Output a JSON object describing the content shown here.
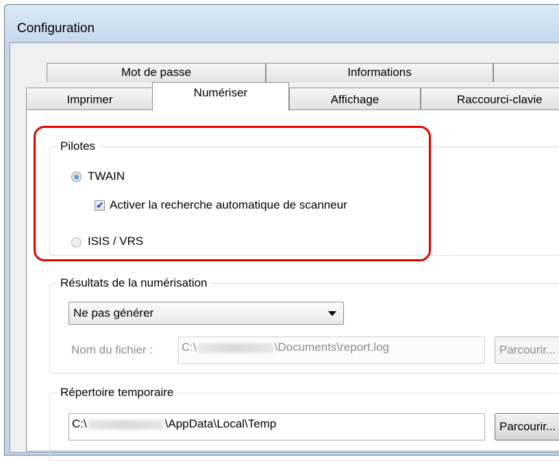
{
  "window": {
    "title": "Configuration"
  },
  "tabs": {
    "row_top": [
      "Mot de passe",
      "Informations",
      ""
    ],
    "row_bottom": [
      "Imprimer",
      "Numériser",
      "Affichage",
      "Raccourci-clavie"
    ]
  },
  "drivers": {
    "group_label": "Pilotes",
    "twain_label": "TWAIN",
    "twain_checked": true,
    "auto_search_label": "Activer la recherche automatique de scanneur",
    "auto_search_checked": true,
    "isis_label": "ISIS / VRS",
    "isis_checked": false
  },
  "scan_results": {
    "group_label": "Résultats de la numérisation",
    "selected_option": "Ne pas générer",
    "filename_label": "Nom du fichier :",
    "filename_prefix": "C:\\",
    "filename_suffix": "\\Documents\\report.log",
    "browse_label": "Parcourir..."
  },
  "temp_dir": {
    "group_label": "Répertoire temporaire",
    "path_prefix": "C:\\",
    "path_suffix": "\\AppData\\Local\\Temp",
    "browse_label": "Parcourir..."
  },
  "colors": {
    "highlight": "#e00000",
    "accent": "#1e5fb0"
  }
}
